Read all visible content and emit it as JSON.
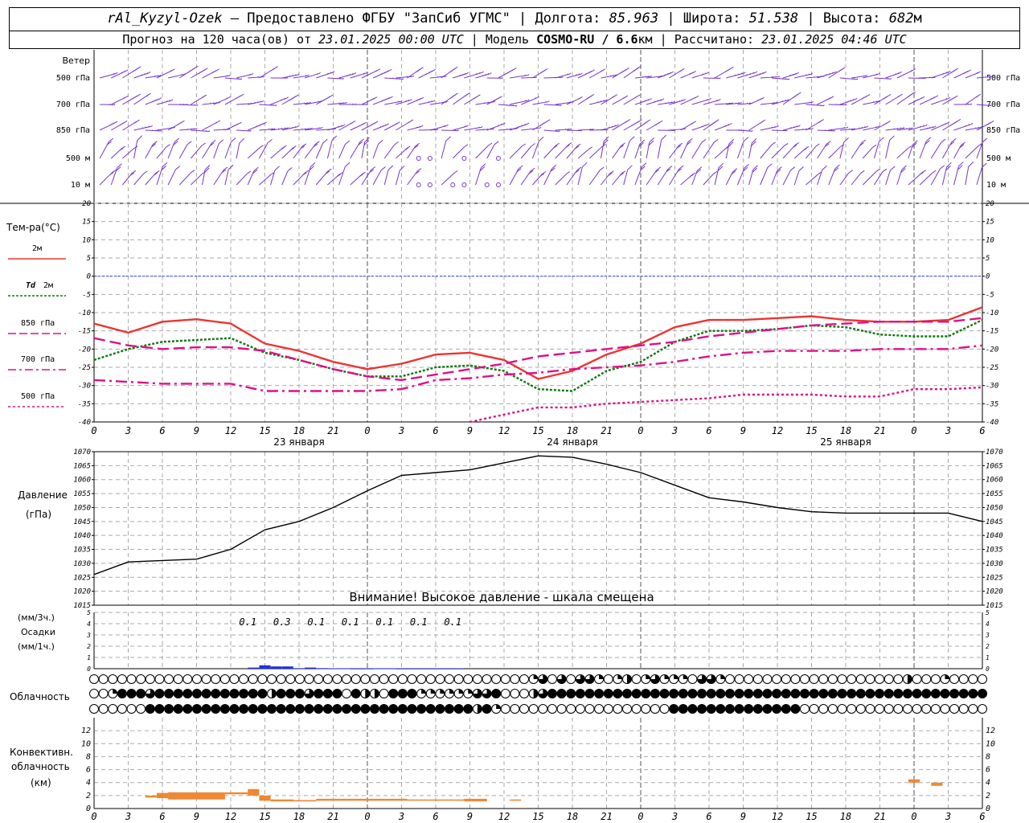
{
  "header": {
    "station": "rAl_Kyzyl-Ozek",
    "provider": "– Предоставлено ФГБУ \"ЗапСиб УГМС\"",
    "lon_label": "Долгота:",
    "lon_value": "85.963",
    "lat_label": "Широта:",
    "lat_value": "51.538",
    "alt_label": "Высота:",
    "alt_value": "682",
    "alt_unit": "м",
    "forecast_prefix": "Прогноз на 120 часа(ов) от",
    "forecast_date": "23.01.2025 00:00 UTC",
    "model_label": "Модель",
    "model_name": "COSMO-RU / 6.6",
    "model_unit": "км",
    "calc_label": "Рассчитано:",
    "calc_date": "23.01.2025 04:46 UTC"
  },
  "chart_data": [
    {
      "type": "wind-barbs",
      "title": "Ветер",
      "levels": [
        "500 гПа",
        "700 гПа",
        "850 гПа",
        "500 м",
        "10 м"
      ]
    },
    {
      "type": "line",
      "ylabel": "Тем-ра(°C)",
      "ylim": [
        -40,
        20
      ],
      "yticks": [
        20,
        15,
        10,
        5,
        0,
        -5,
        -10,
        -15,
        -20,
        -25,
        -30,
        -35,
        -40
      ],
      "x": [
        0,
        3,
        6,
        9,
        12,
        15,
        18,
        21,
        24,
        27,
        30,
        33,
        36,
        39,
        42,
        45,
        48,
        51,
        54,
        57,
        60,
        63,
        66,
        69,
        72,
        75,
        78
      ],
      "xtick_labels": [
        "0",
        "3",
        "6",
        "9",
        "12",
        "15",
        "18",
        "21",
        "0",
        "3",
        "6",
        "9",
        "12",
        "15",
        "18",
        "21",
        "0",
        "3",
        "6",
        "9",
        "12",
        "15",
        "18",
        "21",
        "0",
        "3",
        "6"
      ],
      "date_labels": [
        "23 января",
        "24 января",
        "25 января"
      ],
      "series": [
        {
          "name": "2м",
          "color": "#ee3333",
          "dash": "solid",
          "values": [
            -13,
            -15.5,
            -12.5,
            -11.8,
            -13,
            -18.5,
            -20.5,
            -23.5,
            -25.5,
            -24,
            -21.5,
            -21,
            -23,
            -28.2,
            -26,
            -21.5,
            -18.5,
            -14,
            -12,
            -12,
            -11.5,
            -11,
            -12,
            -12.5,
            -12.5,
            -12,
            -8.5
          ]
        },
        {
          "name": "Td 2м",
          "color": "#117711",
          "dash": "dotted",
          "values": [
            -23,
            -20,
            -18,
            -17.5,
            -17,
            -21,
            -23,
            -25.5,
            -27.5,
            -27.5,
            -25,
            -24.5,
            -26,
            -31,
            -31.5,
            -26,
            -23.5,
            -18,
            -15,
            -15,
            -14.5,
            -13.5,
            -14,
            -16,
            -16.5,
            -16.5,
            -12
          ]
        },
        {
          "name": "850 гПа",
          "color": "#dd1188",
          "dash": "dashed",
          "values": [
            -17,
            -19,
            -20,
            -19.5,
            -19.5,
            -20.5,
            -23,
            -25.5,
            -27.5,
            -28.5,
            -27,
            -25.5,
            -24,
            -22,
            -21,
            -20,
            -19,
            -18,
            -16.5,
            -15.5,
            -14.5,
            -13.5,
            -13,
            -12.5,
            -12.5,
            -12.5,
            -11.5
          ]
        },
        {
          "name": "700 гПа",
          "color": "#dd1188",
          "dash": "dashdot",
          "values": [
            -28.5,
            -29,
            -29.5,
            -29.5,
            -29.5,
            -31.5,
            -31.5,
            -31.5,
            -31.5,
            -31,
            -28.5,
            -28,
            -27,
            -26.5,
            -25.5,
            -25,
            -24.5,
            -23.5,
            -22,
            -21,
            -20.5,
            -20.5,
            -20.5,
            -20,
            -20,
            -20,
            -19
          ]
        },
        {
          "name": "500 гПа",
          "color": "#dd1188",
          "dash": "densedot",
          "values": [
            null,
            null,
            null,
            null,
            null,
            null,
            null,
            null,
            null,
            null,
            null,
            -40,
            -38,
            -36,
            -36,
            -35,
            -34.5,
            -34,
            -33.5,
            -32.5,
            -32.5,
            -32.5,
            -33,
            -33,
            -31,
            -31,
            -30.5
          ]
        }
      ]
    },
    {
      "type": "line",
      "ylabel": "Давление",
      "yunit": "(гПа)",
      "ylim": [
        1015,
        1070
      ],
      "yticks": [
        1070,
        1065,
        1060,
        1055,
        1050,
        1045,
        1040,
        1035,
        1030,
        1025,
        1020,
        1015
      ],
      "warning": "Внимание! Высокое давление - шкала смещена",
      "x": [
        0,
        3,
        6,
        9,
        12,
        15,
        18,
        21,
        24,
        27,
        30,
        33,
        36,
        39,
        42,
        45,
        48,
        51,
        54,
        57,
        60,
        63,
        66,
        69,
        72,
        75,
        78
      ],
      "values": [
        1026,
        1030.5,
        1031,
        1031.5,
        1035,
        1042,
        1045,
        1050,
        1056,
        1061.5,
        1062.5,
        1063.5,
        1066,
        1068.5,
        1068,
        1065.5,
        1062.5,
        1058,
        1053.5,
        1052,
        1050,
        1048.5,
        1048,
        1048,
        1048,
        1048,
        1045
      ]
    },
    {
      "type": "bar",
      "ylabel_top": "(мм/3ч.)",
      "ylabel_mid": "Осадки",
      "ylabel_bot": "(мм/1ч.)",
      "ylim": [
        0,
        5
      ],
      "yticks": [
        5,
        4,
        3,
        2,
        1,
        0
      ],
      "labels": [
        "0.1",
        "0.3",
        "0.1",
        "0.1",
        "0.1",
        "0.1",
        "0.1"
      ],
      "label_x": [
        13.5,
        16.5,
        19.5,
        22.5,
        25.5,
        28.5,
        31.5
      ],
      "hourly_x": [
        14,
        15,
        16,
        17,
        18,
        19,
        20,
        21,
        22,
        23,
        24,
        25,
        26,
        27,
        28,
        29,
        30,
        31,
        32
      ],
      "hourly_values": [
        0.1,
        0.3,
        0.2,
        0.2,
        0.05,
        0.1,
        0.05,
        0.03,
        0.03,
        0.02,
        0.02,
        0.03,
        0.03,
        0.02,
        0.02,
        0.02,
        0.02,
        0.02,
        0.02
      ]
    },
    {
      "type": "cloud-symbols",
      "title": "Облачность",
      "rows": [
        {
          "level": "upper",
          "code": "000000000000000000000000000000000000000000000001303033101201311103310000000000000000000200010000"
        },
        {
          "level": "middle",
          "code": "001444344444444444424443444042204441111113340002344444444444444444444444444444444444444444444444"
        },
        {
          "level": "lower",
          "code": "000000444444444444444444444444444444444442410000000000000000004444444444444400000000000000000000"
        }
      ]
    },
    {
      "type": "bar",
      "ylabel_1": "Конвективн.",
      "ylabel_2": "облачность",
      "ylabel_3": "(км)",
      "ylim": [
        0,
        14
      ],
      "yticks": [
        12,
        10,
        8,
        6,
        4,
        2,
        0
      ],
      "color": "#ee8833",
      "segments": [
        {
          "x0": 4.5,
          "x1": 5.5,
          "base": 1.7,
          "top": 2.0
        },
        {
          "x0": 5.5,
          "x1": 6.5,
          "base": 1.6,
          "top": 2.4
        },
        {
          "x0": 6.5,
          "x1": 11.5,
          "base": 1.4,
          "top": 2.5
        },
        {
          "x0": 11.5,
          "x1": 13.5,
          "base": 2.2,
          "top": 2.5
        },
        {
          "x0": 13.5,
          "x1": 14.5,
          "base": 2.0,
          "top": 3.0
        },
        {
          "x0": 14.5,
          "x1": 15.5,
          "base": 1.2,
          "top": 2.0
        },
        {
          "x0": 15.5,
          "x1": 17.5,
          "base": 1.1,
          "top": 1.4
        },
        {
          "x0": 17.5,
          "x1": 19.5,
          "base": 1.1,
          "top": 1.3
        },
        {
          "x0": 19.5,
          "x1": 27.5,
          "base": 1.2,
          "top": 1.5
        },
        {
          "x0": 27.5,
          "x1": 32.5,
          "base": 1.2,
          "top": 1.4
        },
        {
          "x0": 32.5,
          "x1": 34.5,
          "base": 1.1,
          "top": 1.5
        },
        {
          "x0": 36.5,
          "x1": 37.5,
          "base": 1.2,
          "top": 1.4
        },
        {
          "x0": 71.5,
          "x1": 72.5,
          "base": 4.0,
          "top": 4.5
        },
        {
          "x0": 73.5,
          "x1": 74.5,
          "base": 3.5,
          "top": 4.0
        }
      ]
    }
  ]
}
